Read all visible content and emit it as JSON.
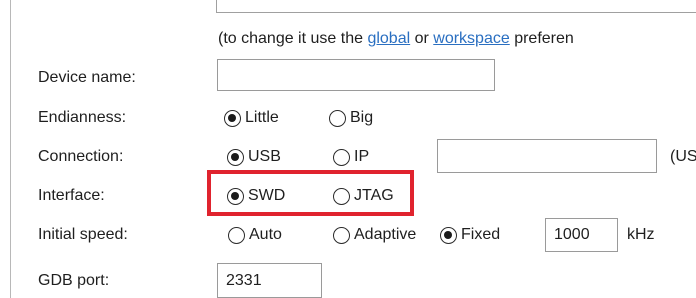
{
  "preferences_note": {
    "prefix": "(to change it use the ",
    "global_link": "global",
    "middle": " or ",
    "workspace_link": "workspace",
    "suffix": " preferen"
  },
  "device_name": {
    "label": "Device name:",
    "value": ""
  },
  "endianness": {
    "label": "Endianness:",
    "options": [
      "Little",
      "Big"
    ],
    "selected": "Little"
  },
  "connection": {
    "label": "Connection:",
    "options": [
      "USB",
      "IP"
    ],
    "selected": "USB",
    "ip_value": "",
    "trailing_text": "(US"
  },
  "interface": {
    "label": "Interface:",
    "options": [
      "SWD",
      "JTAG"
    ],
    "selected": "SWD",
    "highlight_color": "#e0232e"
  },
  "initial_speed": {
    "label": "Initial speed:",
    "options": [
      "Auto",
      "Adaptive",
      "Fixed"
    ],
    "selected": "Fixed",
    "fixed_value": "1000",
    "unit": "kHz"
  },
  "gdb_port": {
    "label": "GDB port:",
    "value": "2331"
  },
  "colors": {
    "link": "#2a6fc1",
    "border": "#9a9a9a"
  }
}
